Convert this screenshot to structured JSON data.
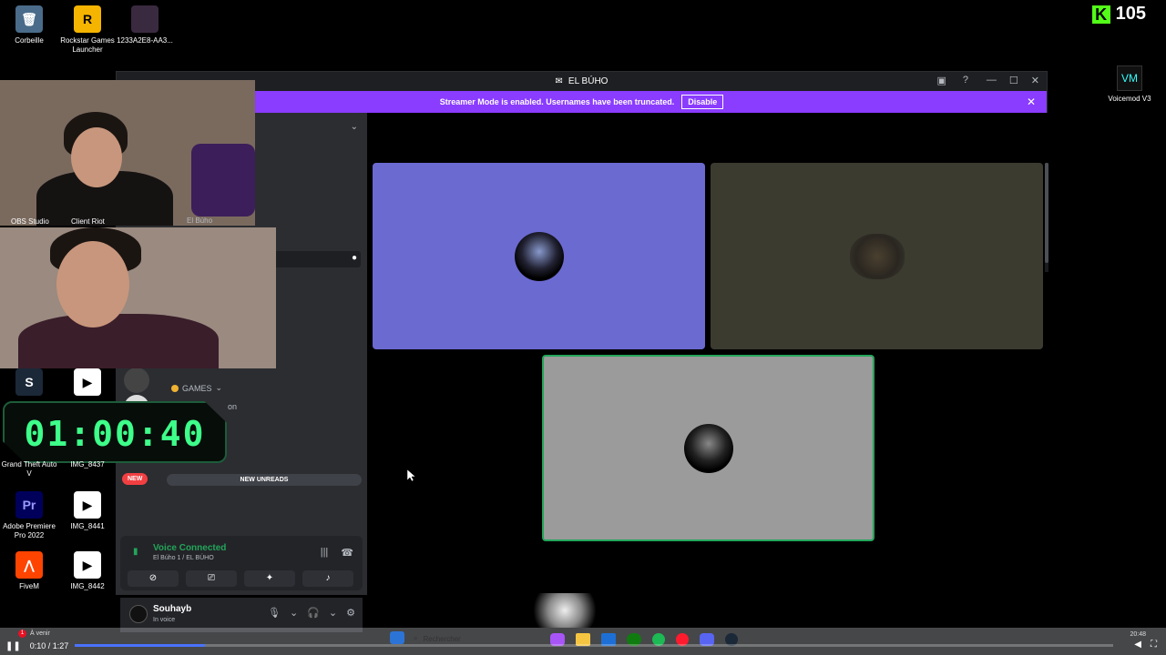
{
  "desktop": {
    "icons": [
      {
        "label": "Corbeille"
      },
      {
        "label": "Rockstar Games Launcher"
      },
      {
        "label": "1233A2E8-AA3..."
      },
      {
        "label": "OBS Studio"
      },
      {
        "label": "Client Riot"
      },
      {
        "label": "Grand Theft Auto V"
      },
      {
        "label": "IMG_8437"
      },
      {
        "label": "Adobe Premiere Pro 2022"
      },
      {
        "label": "IMG_8441"
      },
      {
        "label": "FiveM"
      },
      {
        "label": "IMG_8442"
      }
    ],
    "voicemod_label": "Voicemod V3",
    "kick_count": "105"
  },
  "discord": {
    "window_title": "EL BÚHO",
    "banner_text": "Streamer Mode is enabled. Usernames have been truncated.",
    "banner_button": "Disable",
    "server_overlay_label": "El Búho",
    "channel_games": "GAMES",
    "channel_partial": "on",
    "new_pill": "NEW",
    "new_unreads": "NEW UNREADS",
    "voice_status": "Voice Connected",
    "voice_channel": "El Búho 1 / EL BÚHO",
    "user_name": "Souhayb",
    "user_sub": "In voice",
    "tile_colors": {
      "tile1": "#6b6ad1",
      "tile2": "#3b3b30",
      "tile3": "#9b9b9b"
    }
  },
  "overlay": {
    "timer": "01:00:40"
  },
  "player": {
    "time": "0:10 / 1:27",
    "progress": 0.125
  },
  "taskbar": {
    "notification_label": "À venir",
    "notification_count": "1",
    "search_placeholder": "Rechercher",
    "clock": "20:48"
  }
}
